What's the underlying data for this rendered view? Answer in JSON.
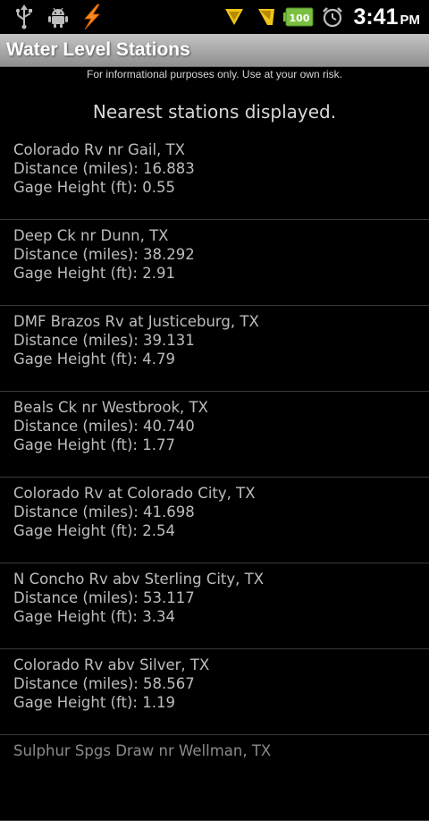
{
  "status_bar": {
    "time": "3:41",
    "ampm": "PM",
    "battery": "100",
    "icons": [
      "usb-icon",
      "android-debug-icon",
      "flash-icon",
      "signal-icon",
      "signal-icon",
      "battery-icon",
      "alarm-icon"
    ]
  },
  "app": {
    "title": "Water Level Stations"
  },
  "disclaimer": "For informational purposes only. Use at your own risk.",
  "heading": "Nearest stations displayed.",
  "stations": [
    {
      "name": "Colorado Rv nr Gail, TX",
      "distance": "Distance (miles): 16.883",
      "gage": "Gage Height (ft): 0.55"
    },
    {
      "name": "Deep Ck nr Dunn, TX",
      "distance": "Distance (miles): 38.292",
      "gage": "Gage Height (ft): 2.91"
    },
    {
      "name": "DMF Brazos Rv at Justiceburg, TX",
      "distance": "Distance (miles): 39.131",
      "gage": "Gage Height (ft): 4.79"
    },
    {
      "name": "Beals Ck nr Westbrook, TX",
      "distance": "Distance (miles): 40.740",
      "gage": "Gage Height (ft): 1.77"
    },
    {
      "name": "Colorado Rv at Colorado City, TX",
      "distance": "Distance (miles): 41.698",
      "gage": "Gage Height (ft): 2.54"
    },
    {
      "name": "N Concho Rv abv Sterling City, TX",
      "distance": "Distance (miles): 53.117",
      "gage": "Gage Height (ft): 3.34"
    },
    {
      "name": "Colorado Rv abv Silver, TX",
      "distance": "Distance (miles): 58.567",
      "gage": "Gage Height (ft): 1.19"
    },
    {
      "name": "Sulphur Spgs Draw nr Wellman, TX"
    }
  ],
  "colors": {
    "background": "#000000",
    "title_bar": "#a9a9a9",
    "text": "#bdbdbd",
    "divider": "#3a3a3a",
    "flash": "#ff8a1c",
    "signal": "#f0c419",
    "battery": "#7bc043"
  }
}
